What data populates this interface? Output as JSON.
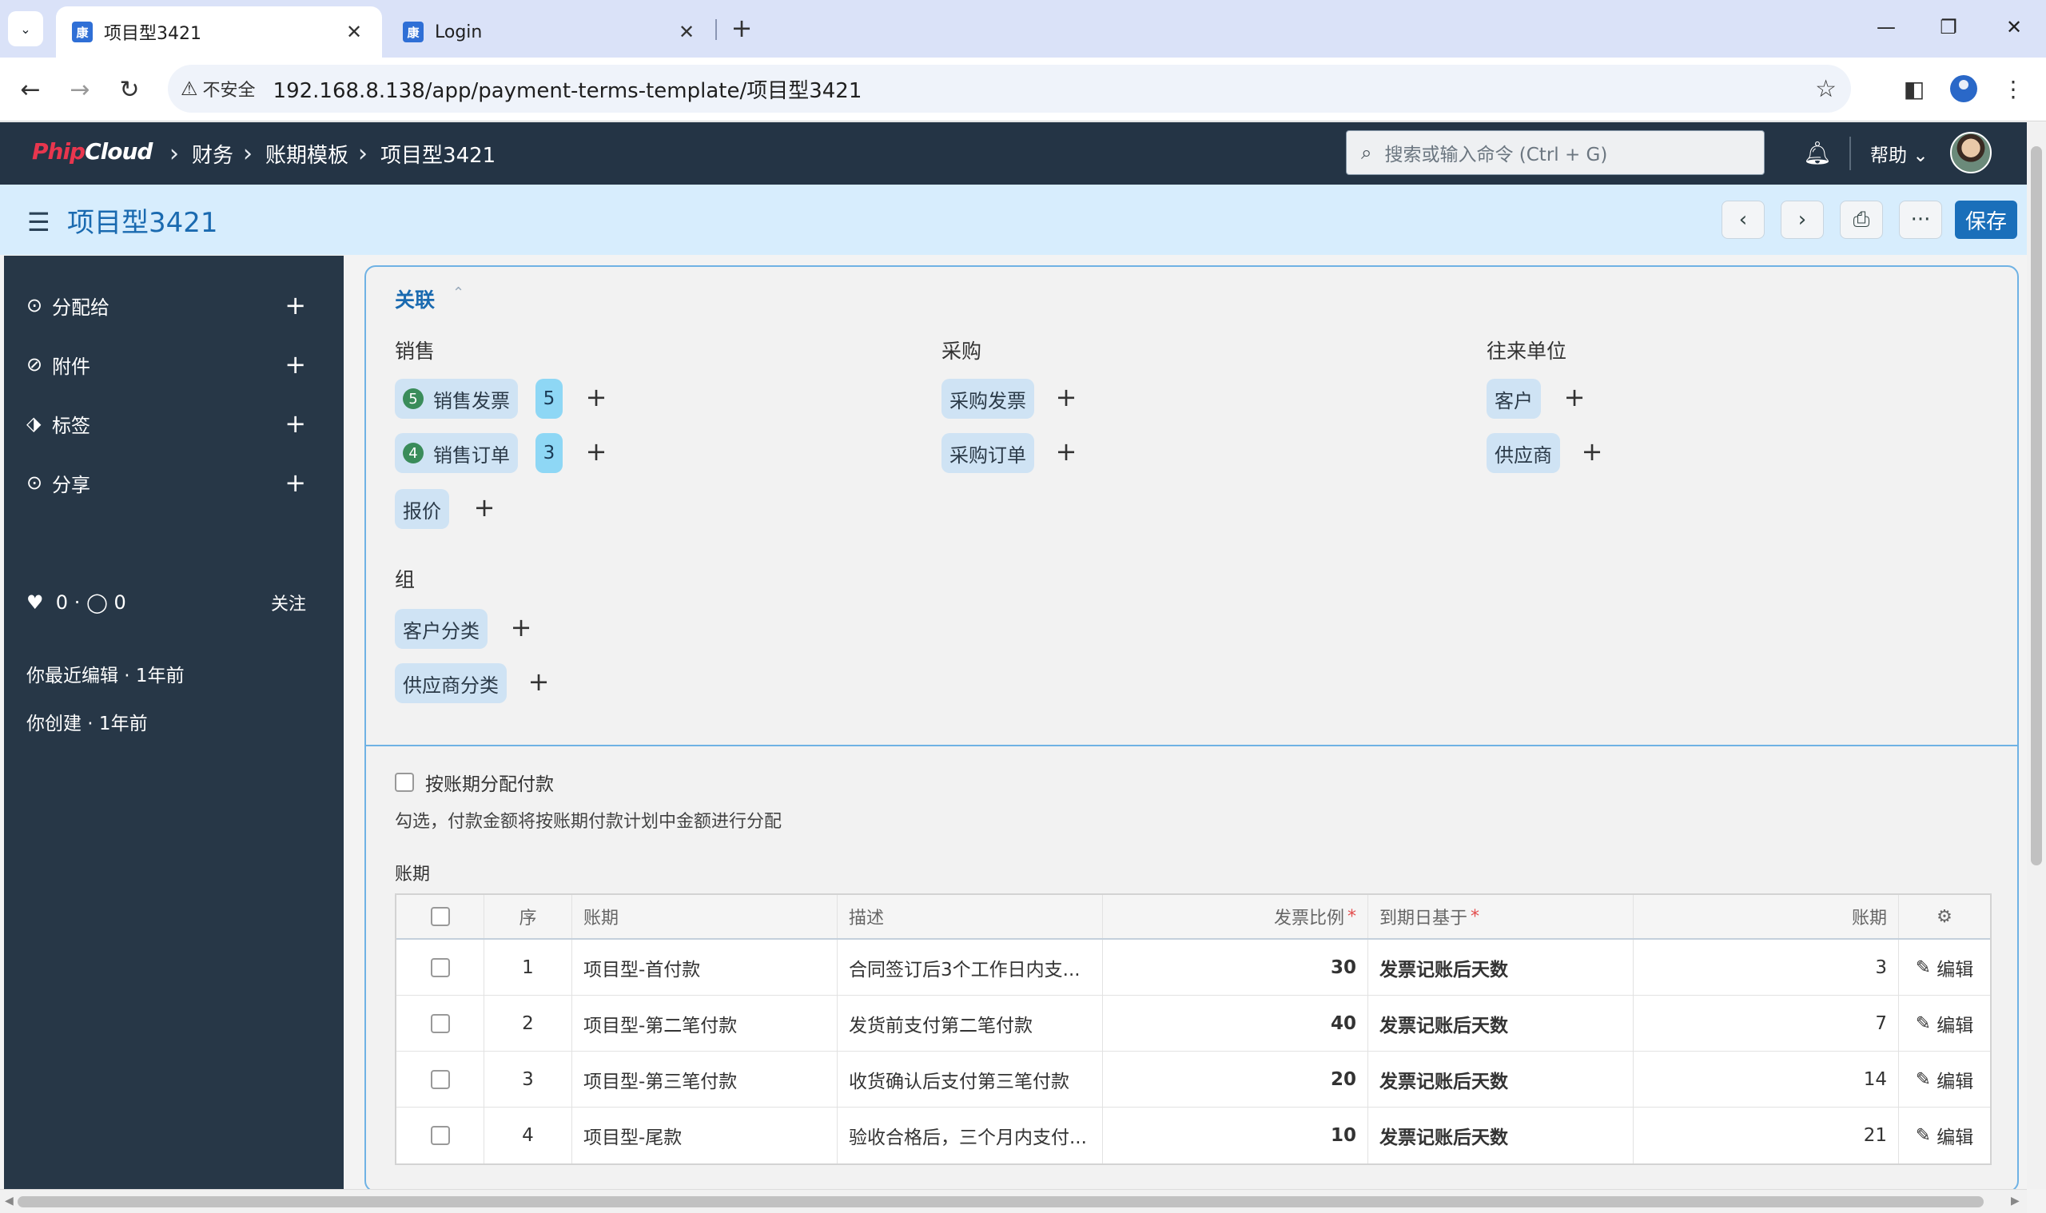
{
  "browser": {
    "tabs": [
      {
        "title": "项目型3421",
        "favicon": "康"
      },
      {
        "title": "Login",
        "favicon": "康"
      }
    ],
    "insecure_label": "不安全",
    "url": "192.168.8.138/app/payment-terms-template/项目型3421"
  },
  "nav": {
    "logo_a": "Phip",
    "logo_b": "Cloud",
    "breadcrumbs": [
      "财务",
      "账期模板",
      "项目型3421"
    ],
    "search_placeholder": "搜索或输入命令 (Ctrl + G)",
    "help": "帮助"
  },
  "page": {
    "title": "项目型3421",
    "save": "保存"
  },
  "sidebar": {
    "items": [
      {
        "label": "分配给"
      },
      {
        "label": "附件"
      },
      {
        "label": "标签"
      },
      {
        "label": "分享"
      }
    ],
    "likes": "0",
    "comments": "0",
    "follow": "关注",
    "last_edit": "你最近编辑 · 1年前",
    "created": "你创建 · 1年前"
  },
  "links": {
    "title": "关联",
    "sales": {
      "heading": "销售",
      "invoice": {
        "label": "销售发票",
        "count": "5",
        "badge": "5"
      },
      "order": {
        "label": "销售订单",
        "count": "4",
        "badge": "3"
      },
      "quote": {
        "label": "报价"
      }
    },
    "purchase": {
      "heading": "采购",
      "invoice": {
        "label": "采购发票"
      },
      "order": {
        "label": "采购订单"
      }
    },
    "party": {
      "heading": "往来单位",
      "customer": {
        "label": "客户"
      },
      "supplier": {
        "label": "供应商"
      }
    },
    "group": {
      "heading": "组",
      "customer_group": {
        "label": "客户分类"
      },
      "supplier_group": {
        "label": "供应商分类"
      }
    }
  },
  "form": {
    "allocate_label": "按账期分配付款",
    "allocate_hint": "勾选，付款金额将按账期付款计划中金额进行分配",
    "table_label": "账期"
  },
  "table": {
    "headers": {
      "idx": "序",
      "term": "账期",
      "desc": "描述",
      "pct": "发票比例",
      "due": "到期日基于",
      "days": "账期"
    },
    "edit_label": "编辑",
    "rows": [
      {
        "idx": "1",
        "term": "项目型-首付款",
        "desc": "合同签订后3个工作日内支...",
        "pct": "30",
        "due": "发票记账后天数",
        "days": "3"
      },
      {
        "idx": "2",
        "term": "项目型-第二笔付款",
        "desc": "发货前支付第二笔付款",
        "pct": "40",
        "due": "发票记账后天数",
        "days": "7"
      },
      {
        "idx": "3",
        "term": "项目型-第三笔付款",
        "desc": "收货确认后支付第三笔付款",
        "pct": "20",
        "due": "发票记账后天数",
        "days": "14"
      },
      {
        "idx": "4",
        "term": "项目型-尾款",
        "desc": "验收合格后，三个月内支付...",
        "pct": "10",
        "due": "发票记账后天数",
        "days": "21"
      }
    ]
  },
  "colors": {
    "nav_bg": "#243445",
    "header_bg": "#d7edfd",
    "accent": "#1a6fba",
    "chip_bg": "#cfe3f4",
    "badge_bg": "#8ed7f5",
    "count_dot": "#3a8c5a"
  }
}
